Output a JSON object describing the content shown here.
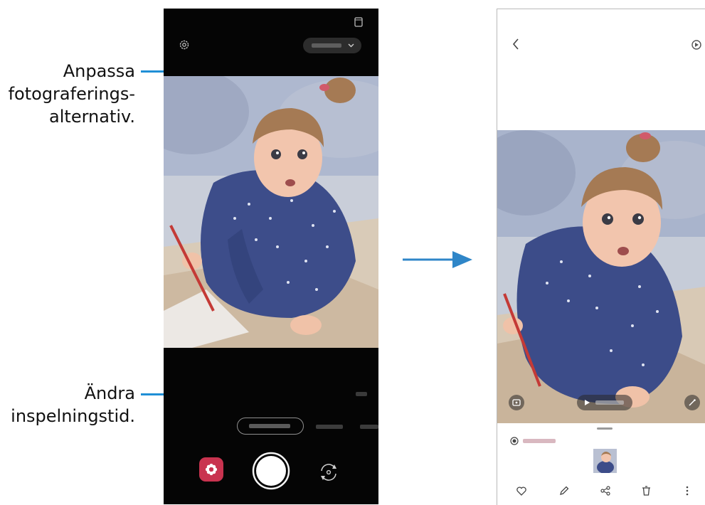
{
  "callouts": {
    "top": [
      "Anpassa",
      "fotograferings-",
      "alternativ."
    ],
    "bottom": [
      "Ändra",
      "inspelningstid."
    ]
  },
  "colors": {
    "callout_line": "#1f8fd6",
    "arrow": "#2f86c8",
    "camera_bg": "#050505",
    "effects_button": "#c9334f"
  },
  "camera": {
    "icons": [
      "settings-icon",
      "aspect-ratio-icon",
      "chevron-down-icon",
      "effects-flower-icon",
      "shutter-icon",
      "switch-camera-icon"
    ]
  },
  "viewer": {
    "icons": [
      "back-icon",
      "motion-icon",
      "video-icon",
      "play-icon",
      "magic-icon",
      "radio-icon",
      "heart-icon",
      "edit-icon",
      "share-icon",
      "trash-icon",
      "more-icon"
    ]
  }
}
